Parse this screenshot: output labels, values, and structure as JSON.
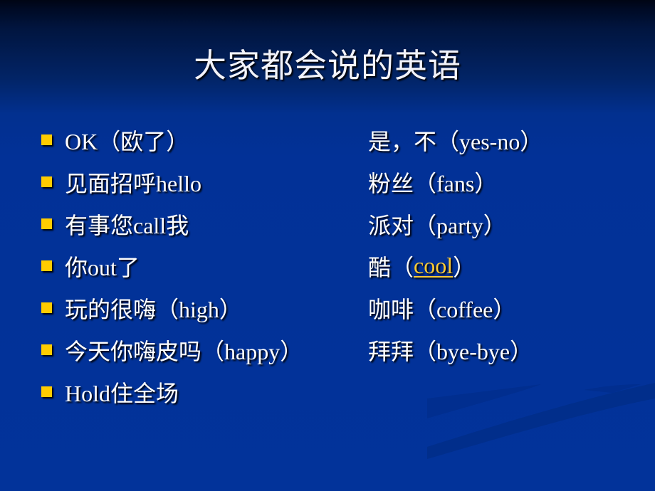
{
  "slide": {
    "title": "大家都会说的英语",
    "colors": {
      "background": "#02339a",
      "text": "#ffffff",
      "bullet": "#ffcc00",
      "link": "#ffcc33"
    },
    "left_items": [
      "OK（欧了）",
      "见面招呼hello",
      "有事您call我",
      "你out了",
      "玩的很嗨（high）",
      "今天你嗨皮吗（happy）",
      "Hold住全场"
    ],
    "right_items": [
      {
        "text": "是，不（yes-no）"
      },
      {
        "text": "粉丝（fans）"
      },
      {
        "text": "派对（party）"
      },
      {
        "prefix": "酷（",
        "link": "cool",
        "suffix": "）"
      },
      {
        "text": "咖啡（coffee）"
      },
      {
        "text": "拜拜（bye-bye）"
      }
    ]
  }
}
